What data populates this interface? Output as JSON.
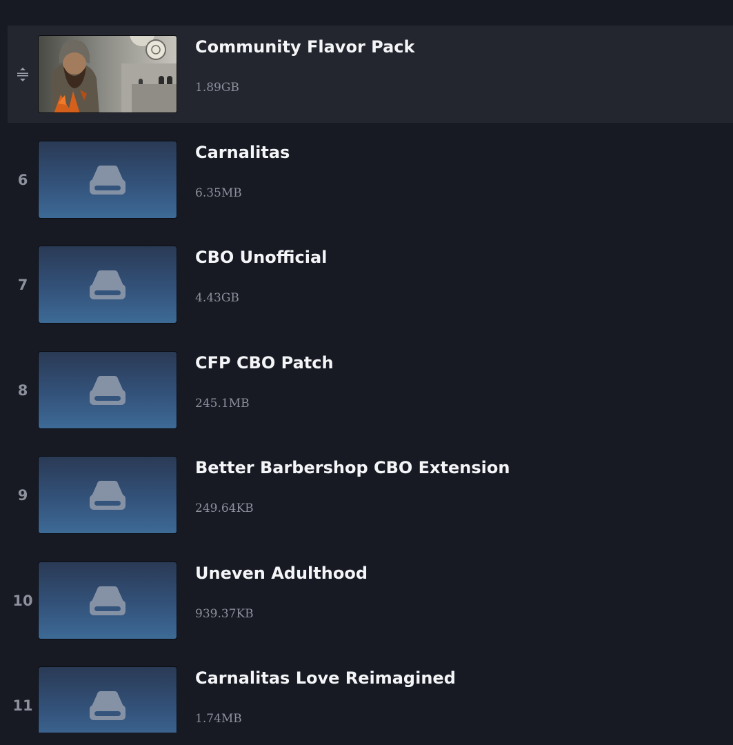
{
  "mods": [
    {
      "order": "",
      "title": "Community Flavor Pack",
      "size": "1.89GB",
      "has_image": true,
      "dragging": true
    },
    {
      "order": "6",
      "title": "Carnalitas",
      "size": "6.35MB",
      "has_image": false
    },
    {
      "order": "7",
      "title": "CBO Unofficial",
      "size": "4.43GB",
      "has_image": false
    },
    {
      "order": "8",
      "title": "CFP CBO Patch",
      "size": "245.1MB",
      "has_image": false
    },
    {
      "order": "9",
      "title": "Better Barbershop CBO Extension",
      "size": "249.64KB",
      "has_image": false
    },
    {
      "order": "10",
      "title": "Uneven Adulthood",
      "size": "939.37KB",
      "has_image": false
    },
    {
      "order": "11",
      "title": "Carnalitas Love Reimagined",
      "size": "1.74MB",
      "has_image": false
    }
  ],
  "icons": {
    "drag_handle": "drag-handle-icon",
    "placeholder": "drive-icon"
  },
  "colors": {
    "background": "#171923",
    "active_row": "#23252f",
    "title_text": "#f4f5f7",
    "muted_text": "#8c919c"
  }
}
